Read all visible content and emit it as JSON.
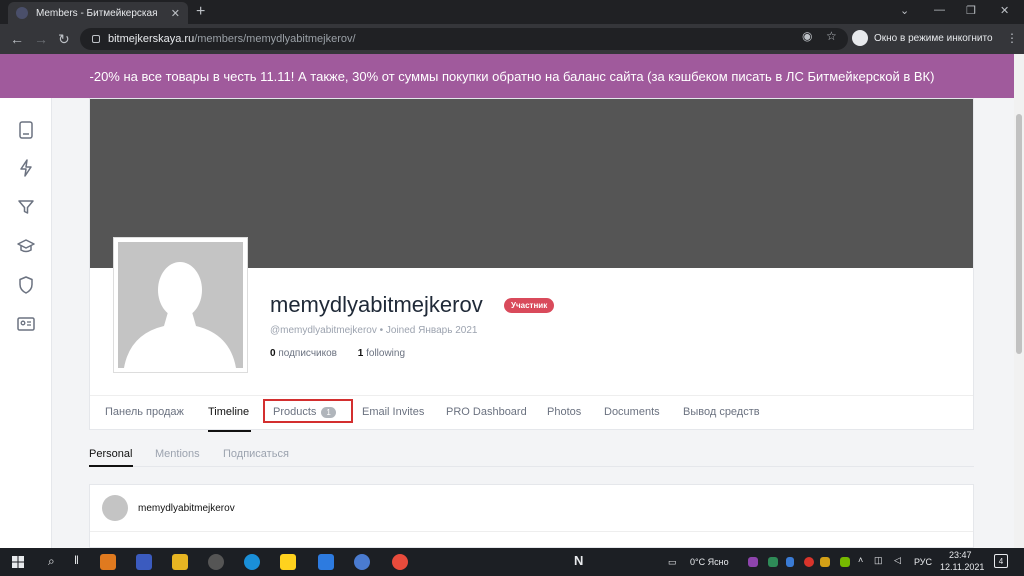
{
  "browser": {
    "tab_title": "Members - Битмейкерская",
    "url_host": "bitmejkerskaya.ru",
    "url_path": "/members/memydlyabitmejkerov/",
    "incognito_label": "Окно в режиме инкогнито"
  },
  "banner": {
    "text": "-20% на все товары в честь 11.11! А также, 30% от суммы покупки обратно на баланс сайта (за кэшбеком писать в ЛС Битмейкерской в ВК)",
    "color": "#a05a9c"
  },
  "profile": {
    "username": "memydlyabitmejkerov",
    "role_badge": "Участник",
    "handle_line": "@memydlyabitmejkerov • Joined Январь 2021",
    "followers_count": "0",
    "followers_label": "подписчиков",
    "following_count": "1",
    "following_label": "following"
  },
  "profile_nav": [
    {
      "label": "Панель продаж"
    },
    {
      "label": "Timeline"
    },
    {
      "label": "Products",
      "count": "1"
    },
    {
      "label": "Email Invites"
    },
    {
      "label": "PRO Dashboard"
    },
    {
      "label": "Photos"
    },
    {
      "label": "Documents"
    },
    {
      "label": "Вывод средств"
    }
  ],
  "sub_tabs": [
    {
      "label": "Personal"
    },
    {
      "label": "Mentions"
    },
    {
      "label": "Подписаться"
    }
  ],
  "post": {
    "author": "memydlyabitmejkerov"
  },
  "taskbar": {
    "weather": "0°C  Ясно",
    "lang": "РУС",
    "time": "23:47",
    "date": "12.11.2021",
    "notifications": "4"
  }
}
